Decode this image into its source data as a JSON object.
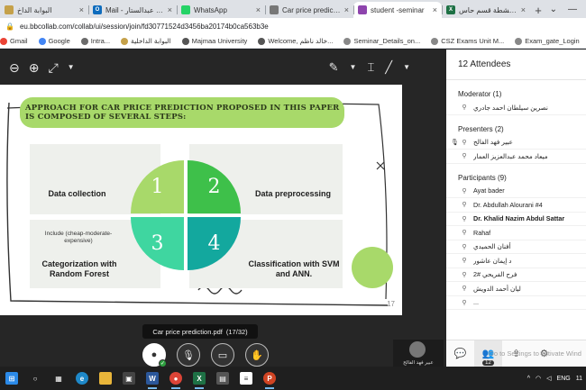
{
  "browser": {
    "tabs": [
      {
        "title": "البوابة الداخ",
        "color": "#c5a14a",
        "letter": "",
        "active": false
      },
      {
        "title": "Mail - ناظم عبدالستار",
        "color": "#0f6cbd",
        "letter": "O",
        "active": false
      },
      {
        "title": "WhatsApp",
        "color": "#25d366",
        "letter": "",
        "active": false
      },
      {
        "title": "Car price prediction",
        "color": "#777777",
        "letter": "",
        "active": false
      },
      {
        "title": "student -seminar",
        "color": "#8e44ad",
        "letter": "",
        "active": true
      },
      {
        "title": "ملف انشطة قسم حاس",
        "color": "#1e7145",
        "letter": "X",
        "active": false
      }
    ],
    "new_tab": "+",
    "url": "eu.bbcollab.com/collab/ui/session/join/fd30771524d3456ba20174b0ca563b3e",
    "bookmarks": [
      {
        "label": "Gmail",
        "color": "#ea4335"
      },
      {
        "label": "Google",
        "color": "#4285f4"
      },
      {
        "label": "Intra...",
        "color": "#6b6b6b"
      },
      {
        "label": "البوابة الداخلية",
        "color": "#c5a14a"
      },
      {
        "label": "Majmaa University",
        "color": "#555555"
      },
      {
        "label": "Welcome, خالد ناظم...",
        "color": "#555555"
      },
      {
        "label": "Seminar_Details_on...",
        "color": "#888888"
      },
      {
        "label": "CSZ Exams Unit M...",
        "color": "#888888"
      },
      {
        "label": "Exam_gate_Login",
        "color": "#888888"
      }
    ]
  },
  "slide": {
    "title": "Approach for car price prediction proposed in this paper is composed of several steps:",
    "steps": [
      {
        "num": "1",
        "label": "Data collection",
        "color": "#a8d96a"
      },
      {
        "num": "2",
        "label": "Data preprocessing",
        "color": "#3ec04a"
      },
      {
        "num": "3",
        "label": "Categorization with Random Forest",
        "sub": "Include (cheap-moderate-expensive)",
        "color": "#3fd6a0"
      },
      {
        "num": "4",
        "label": "Classification with SVM and ANN.",
        "color": "#13a89e"
      }
    ],
    "page_number": "17"
  },
  "session": {
    "file_label": "Car price prediction.pdf",
    "file_page": "(17/32)",
    "speaker_name": "عبير فهد الفالح"
  },
  "panel": {
    "header": "12 Attendees",
    "moderator_label": "Moderator (1)",
    "moderators": [
      {
        "name": "نصرين سيلطان احمد جادري"
      }
    ],
    "presenters_label": "Presenters (2)",
    "presenters": [
      {
        "name": "عبير فهد الفالح"
      },
      {
        "name": "ميعاد محمد عبدالعزيز العمار"
      }
    ],
    "participants_label": "Participants (9)",
    "participants": [
      {
        "name": "Ayat bader",
        "bold": false,
        "rtl": false
      },
      {
        "name": "Dr. Abdullah Alourani #4",
        "bold": false,
        "rtl": false
      },
      {
        "name": "Dr. Khalid Nazim Abdul Sattar",
        "bold": true,
        "rtl": false
      },
      {
        "name": "Rahaf",
        "bold": false,
        "rtl": false
      },
      {
        "name": "أفنان الحميدي",
        "bold": false,
        "rtl": false
      },
      {
        "name": "د إيمان عاشور",
        "bold": false,
        "rtl": false
      },
      {
        "name": "فرح الفريحي #2",
        "bold": false,
        "rtl": false
      },
      {
        "name": "ليان أحمد الدويش",
        "bold": false,
        "rtl": false
      },
      {
        "name": "...",
        "bold": false,
        "rtl": false
      }
    ],
    "attendee_count": "12",
    "watermark": "Go to Settings to activate Wind"
  },
  "taskbar": {
    "lang": "ENG",
    "time": "11"
  }
}
